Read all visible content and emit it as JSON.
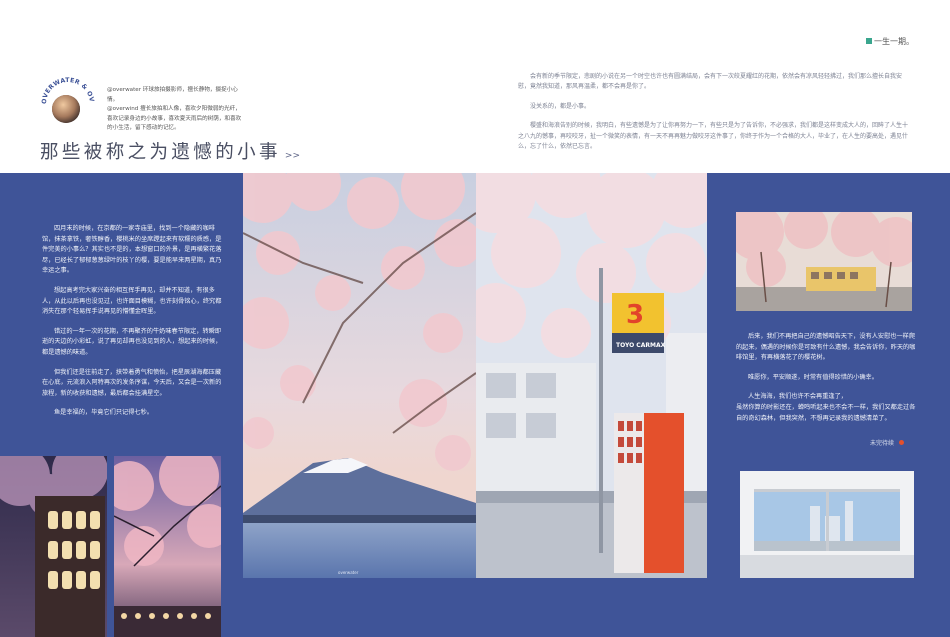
{
  "page_tag": "一生一期。",
  "author": {
    "badge_text": "OVERWATER & OVERWIND",
    "line1": "@overwater 环球旅拍摄影师，擅长静物，摄捉小心情。",
    "line2": "@overwind 擅长旅拍和人像，喜欢夕阳微弱的光纤，喜欢记录身边的小故事，喜欢夏天雨后的树荫，和喜欢的小生活，留下感动的记忆。"
  },
  "title": "那些被称之为遗憾的小事",
  "title_arrow": ">>",
  "right_top_paragraphs": [
    "会有新的季节限定，悲剧的小说在另一个时空也许也有圆满结局，会有下一次皎夏耀红的花期，依然会有凉风轻轻拂过，我们那么擅长自我安慰，竟然我知道，那风再温柔，都不会再是你了。",
    "没关系的，都是小事。",
    "樱盛和海浪告别的时候，我明白，有些遗憾是为了让你再努力一下，有些只是为了告诉你，不必强求，我们都是这样变成大人的，回眸了人生十之八九的憾事，再咬咬牙，扯一个微笑的表情，有一天不再再魅力做咬牙这件事了，你终于作为一个合格的大人，毕业了，在人生的要高处，遇见什么，忘了什么，依然已忘言。"
  ],
  "left_paragraphs": [
    "四月末的时候，在京都的一家寺庙里，找到一个隐藏的咖啡馆，抹茶拿铁，奢铁醇香，櫻桃米的坐席蹚起来有软糯的质感，是件完美的小事么？其实也不是的，本想窗口的外景，是再横繁花落尽，已经长了郁郁葱葱绿叶的枝丫的樱，要是能早来两星期，真乃幸运之事。",
    "想起高考完大家兴奋的相互挥手再见，却并不知道，有很多人，从此以后再也没见过，也许面目模糊，也许刻骨铭心，终究都消失在那个轻易挥手说再见的懵懂金晖里。",
    "错过的一年一次的花期，不再聚齐的牛奶味春节限定，转瞬即逝的天边的小彩虹，说了再见却再也没见到的人，想起来的时候，都是遗憾的味道。",
    "但我们还是往前走了，挟带着勇气和愤怡，把星辰湖海都压藏在心底，元流浪入阿特再次的发条序谋，今天后，又会是一次新的旅程，新的收获和遗憾，最后都会挂满星空。",
    "鱼是幸福的，毕竟它们只记得七秒。"
  ],
  "right_bottom_paragraphs": [
    "后来，我们不再把自己的遗憾昭告天下，没有人安慰也一样爬的起来，偶遇的时候你是可致有什么遗憾，我会告诉你，昨天的咖啡馆里，有再横落花了的樱花树。",
    "唯愿你，平安顺遂，时常有值得珍惜的小确幸。",
    "人生海海，我们也许不会再重逢了，\n虽然你算的时影还在，蝉鸣听起来也不会不一样，我们又都走过各自的奇幻森林，但我突然，不想再记录我的遗憾清单了。"
  ],
  "footer_note": "未完待续",
  "sign_text": "TOYO CARMAX",
  "sign_number": "3",
  "photo_credit": "overwater",
  "colors": {
    "band_blue": "#3f5498",
    "accent_teal": "#3aa68e",
    "title_gray": "#4a4f63"
  }
}
